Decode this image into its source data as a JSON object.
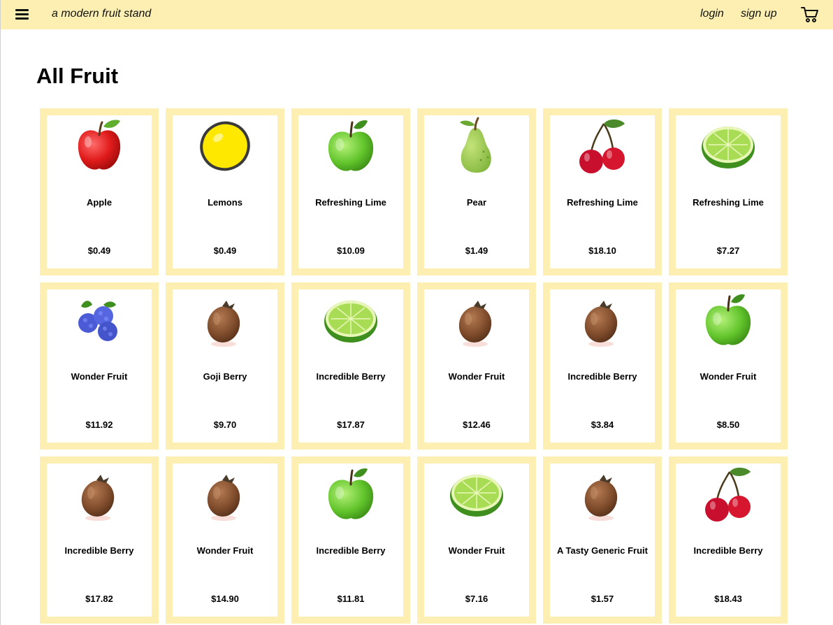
{
  "header": {
    "brand": "a modern fruit stand",
    "login": "login",
    "signup": "sign up",
    "bg_color": "#fdefb2"
  },
  "main": {
    "title": "All Fruit"
  },
  "products": [
    {
      "name": "Apple",
      "price": "$0.49",
      "icon": "red-apple"
    },
    {
      "name": "Lemons",
      "price": "$0.49",
      "icon": "lemon"
    },
    {
      "name": "Refreshing Lime",
      "price": "$10.09",
      "icon": "green-apple"
    },
    {
      "name": "Pear",
      "price": "$1.49",
      "icon": "pear"
    },
    {
      "name": "Refreshing Lime",
      "price": "$18.10",
      "icon": "cherries"
    },
    {
      "name": "Refreshing Lime",
      "price": "$7.27",
      "icon": "lime-half"
    },
    {
      "name": "Wonder Fruit",
      "price": "$11.92",
      "icon": "blueberries"
    },
    {
      "name": "Goji Berry",
      "price": "$9.70",
      "icon": "brown-fruit"
    },
    {
      "name": "Incredible Berry",
      "price": "$17.87",
      "icon": "lime-half"
    },
    {
      "name": "Wonder Fruit",
      "price": "$12.46",
      "icon": "brown-fruit"
    },
    {
      "name": "Incredible Berry",
      "price": "$3.84",
      "icon": "brown-fruit"
    },
    {
      "name": "Wonder Fruit",
      "price": "$8.50",
      "icon": "green-apple"
    },
    {
      "name": "Incredible Berry",
      "price": "$17.82",
      "icon": "brown-fruit"
    },
    {
      "name": "Wonder Fruit",
      "price": "$14.90",
      "icon": "brown-fruit"
    },
    {
      "name": "Incredible Berry",
      "price": "$11.81",
      "icon": "green-apple"
    },
    {
      "name": "Wonder Fruit",
      "price": "$7.16",
      "icon": "lime-half"
    },
    {
      "name": "A Tasty Generic Fruit",
      "price": "$1.57",
      "icon": "brown-fruit"
    },
    {
      "name": "Incredible Berry",
      "price": "$18.43",
      "icon": "cherries"
    }
  ]
}
